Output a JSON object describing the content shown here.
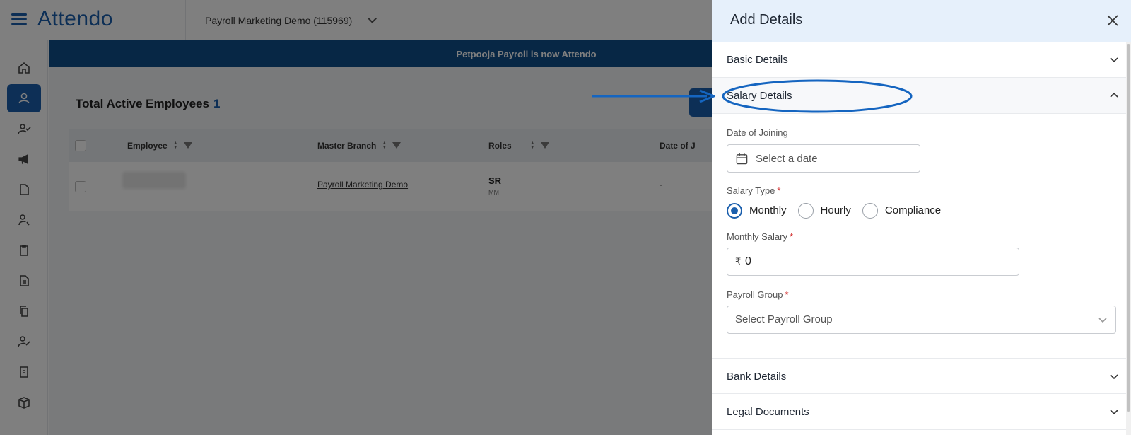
{
  "app": {
    "logo": "Attendo",
    "org_selector": "Payroll Marketing Demo (115969)",
    "banner": "Petpooja Payroll is now Attendo"
  },
  "sidebar": {
    "icons": [
      "home-icon",
      "employees-icon",
      "user-check-icon",
      "megaphone-icon",
      "document-icon",
      "user-settings-icon",
      "clipboard-icon",
      "file-icon",
      "copy-icon",
      "user-edit-icon",
      "report-icon",
      "box-icon"
    ],
    "active_index": 1
  },
  "employees": {
    "title": "Total Active Employees",
    "count": "1",
    "columns": [
      "Employee",
      "Master Branch",
      "Roles",
      "Date of J"
    ],
    "row": {
      "branch": "Payroll Marketing Demo",
      "role": "SR",
      "role_sub": "MM",
      "date": "-"
    }
  },
  "drawer": {
    "title": "Add Details",
    "sections": {
      "basic": "Basic Details",
      "salary": "Salary Details",
      "bank": "Bank Details",
      "legal": "Legal Documents"
    },
    "salary": {
      "date_label": "Date of Joining",
      "date_placeholder": "Select a date",
      "type_label": "Salary Type",
      "type_options": [
        "Monthly",
        "Hourly",
        "Compliance"
      ],
      "type_selected": "Monthly",
      "monthly_label": "Monthly Salary",
      "currency_symbol": "₹",
      "monthly_value": "0",
      "group_label": "Payroll Group",
      "group_placeholder": "Select Payroll Group",
      "required_marker": "*"
    }
  },
  "colors": {
    "brand": "#1b5fad",
    "banner": "#0f4f8a",
    "drawer_header": "#e6f0fb",
    "required": "#d32f2f",
    "annotation": "#1565c0"
  }
}
